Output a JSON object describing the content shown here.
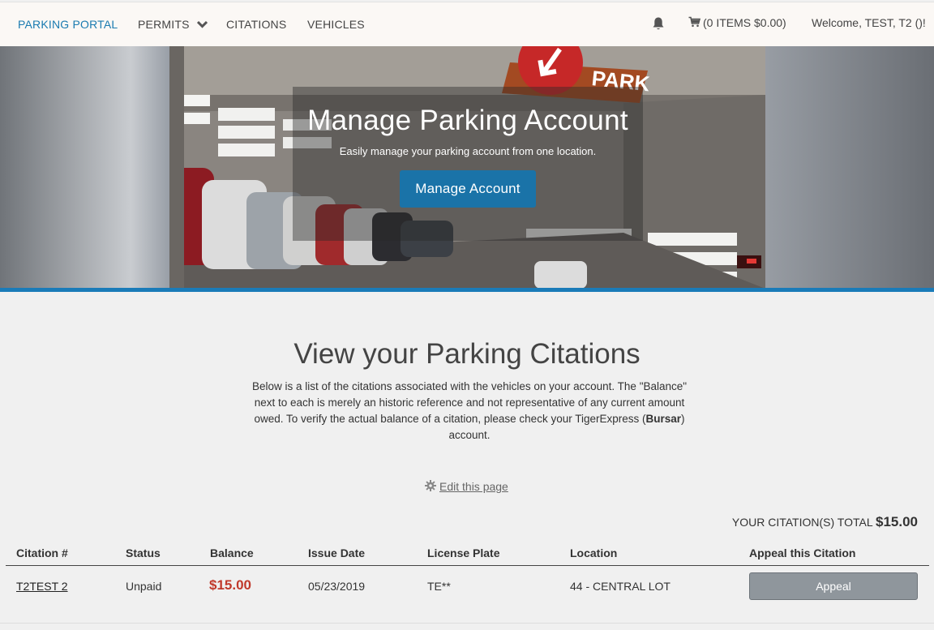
{
  "nav": {
    "brand": "PARKING PORTAL",
    "permits": "PERMITS",
    "citations": "CITATIONS",
    "vehicles": "VEHICLES",
    "cart": "(0 ITEMS $0.00)",
    "welcome": "Welcome, TEST, T2 ()!"
  },
  "hero": {
    "sign_text": "PARK",
    "title": "Manage Parking Account",
    "subtitle": "Easily manage your parking account from one location.",
    "button": "Manage Account"
  },
  "page": {
    "title": "View your Parking Citations",
    "desc_part1": "Below is a list of the citations associated with the vehicles on your account.  The \"Balance\" next to each is merely an historic reference and not representative of any current amount owed. To verify the actual balance of a citation, please check your TigerExpress (",
    "desc_bold": "Bursar",
    "desc_part2": ") account.",
    "edit_link": "Edit this page"
  },
  "total": {
    "label": "YOUR CITATION(S) TOTAL",
    "amount": "$15.00"
  },
  "table": {
    "headers": [
      "Citation #",
      "Status",
      "Balance",
      "Issue Date",
      "License Plate",
      "Location",
      "Appeal this Citation"
    ],
    "rows": [
      {
        "citation": "T2TEST 2",
        "status": "Unpaid",
        "balance": "$15.00",
        "issue_date": "05/23/2019",
        "plate": "TE**",
        "location": "44 - CENTRAL LOT",
        "appeal": "Appeal"
      }
    ]
  },
  "colors": {
    "accent": "#1a7bb8",
    "brand": "#1a7bb0",
    "balance": "#c0392b",
    "button": "#1a73a8"
  },
  "icons": [
    "chevron-down-icon",
    "bell-icon",
    "cart-icon",
    "gear-icon"
  ]
}
